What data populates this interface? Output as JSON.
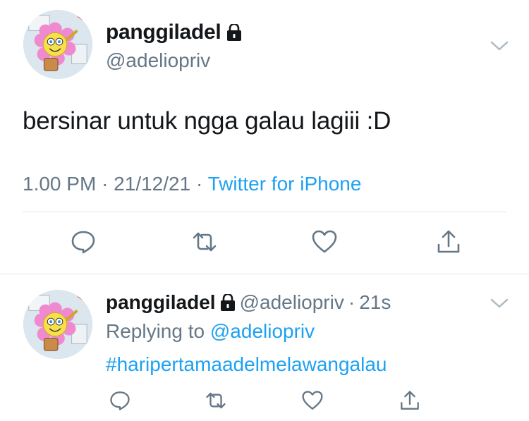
{
  "main_tweet": {
    "display_name": "panggiladel",
    "handle": "@adeliopriv",
    "text": "bersinar untuk ngga galau lagiii :D",
    "time": "1.00 PM",
    "date": "21/12/21",
    "separator": "·",
    "source": "Twitter for iPhone"
  },
  "reply_tweet": {
    "display_name": "panggiladel",
    "handle": "@adeliopriv",
    "separator": "·",
    "age": "21s",
    "replying_prefix": "Replying to",
    "replying_to": "@adeliopriv",
    "hashtag": "#haripertamaadelmelawangalau"
  },
  "icons": {
    "lock": "lock-icon",
    "chevron": "chevron-down-icon",
    "reply": "reply-icon",
    "retweet": "retweet-icon",
    "like": "heart-icon",
    "share": "share-icon"
  },
  "colors": {
    "text": "#14171a",
    "secondary": "#657786",
    "link": "#1da1f2",
    "divider": "#e1e8ed",
    "icon": "#657786"
  }
}
